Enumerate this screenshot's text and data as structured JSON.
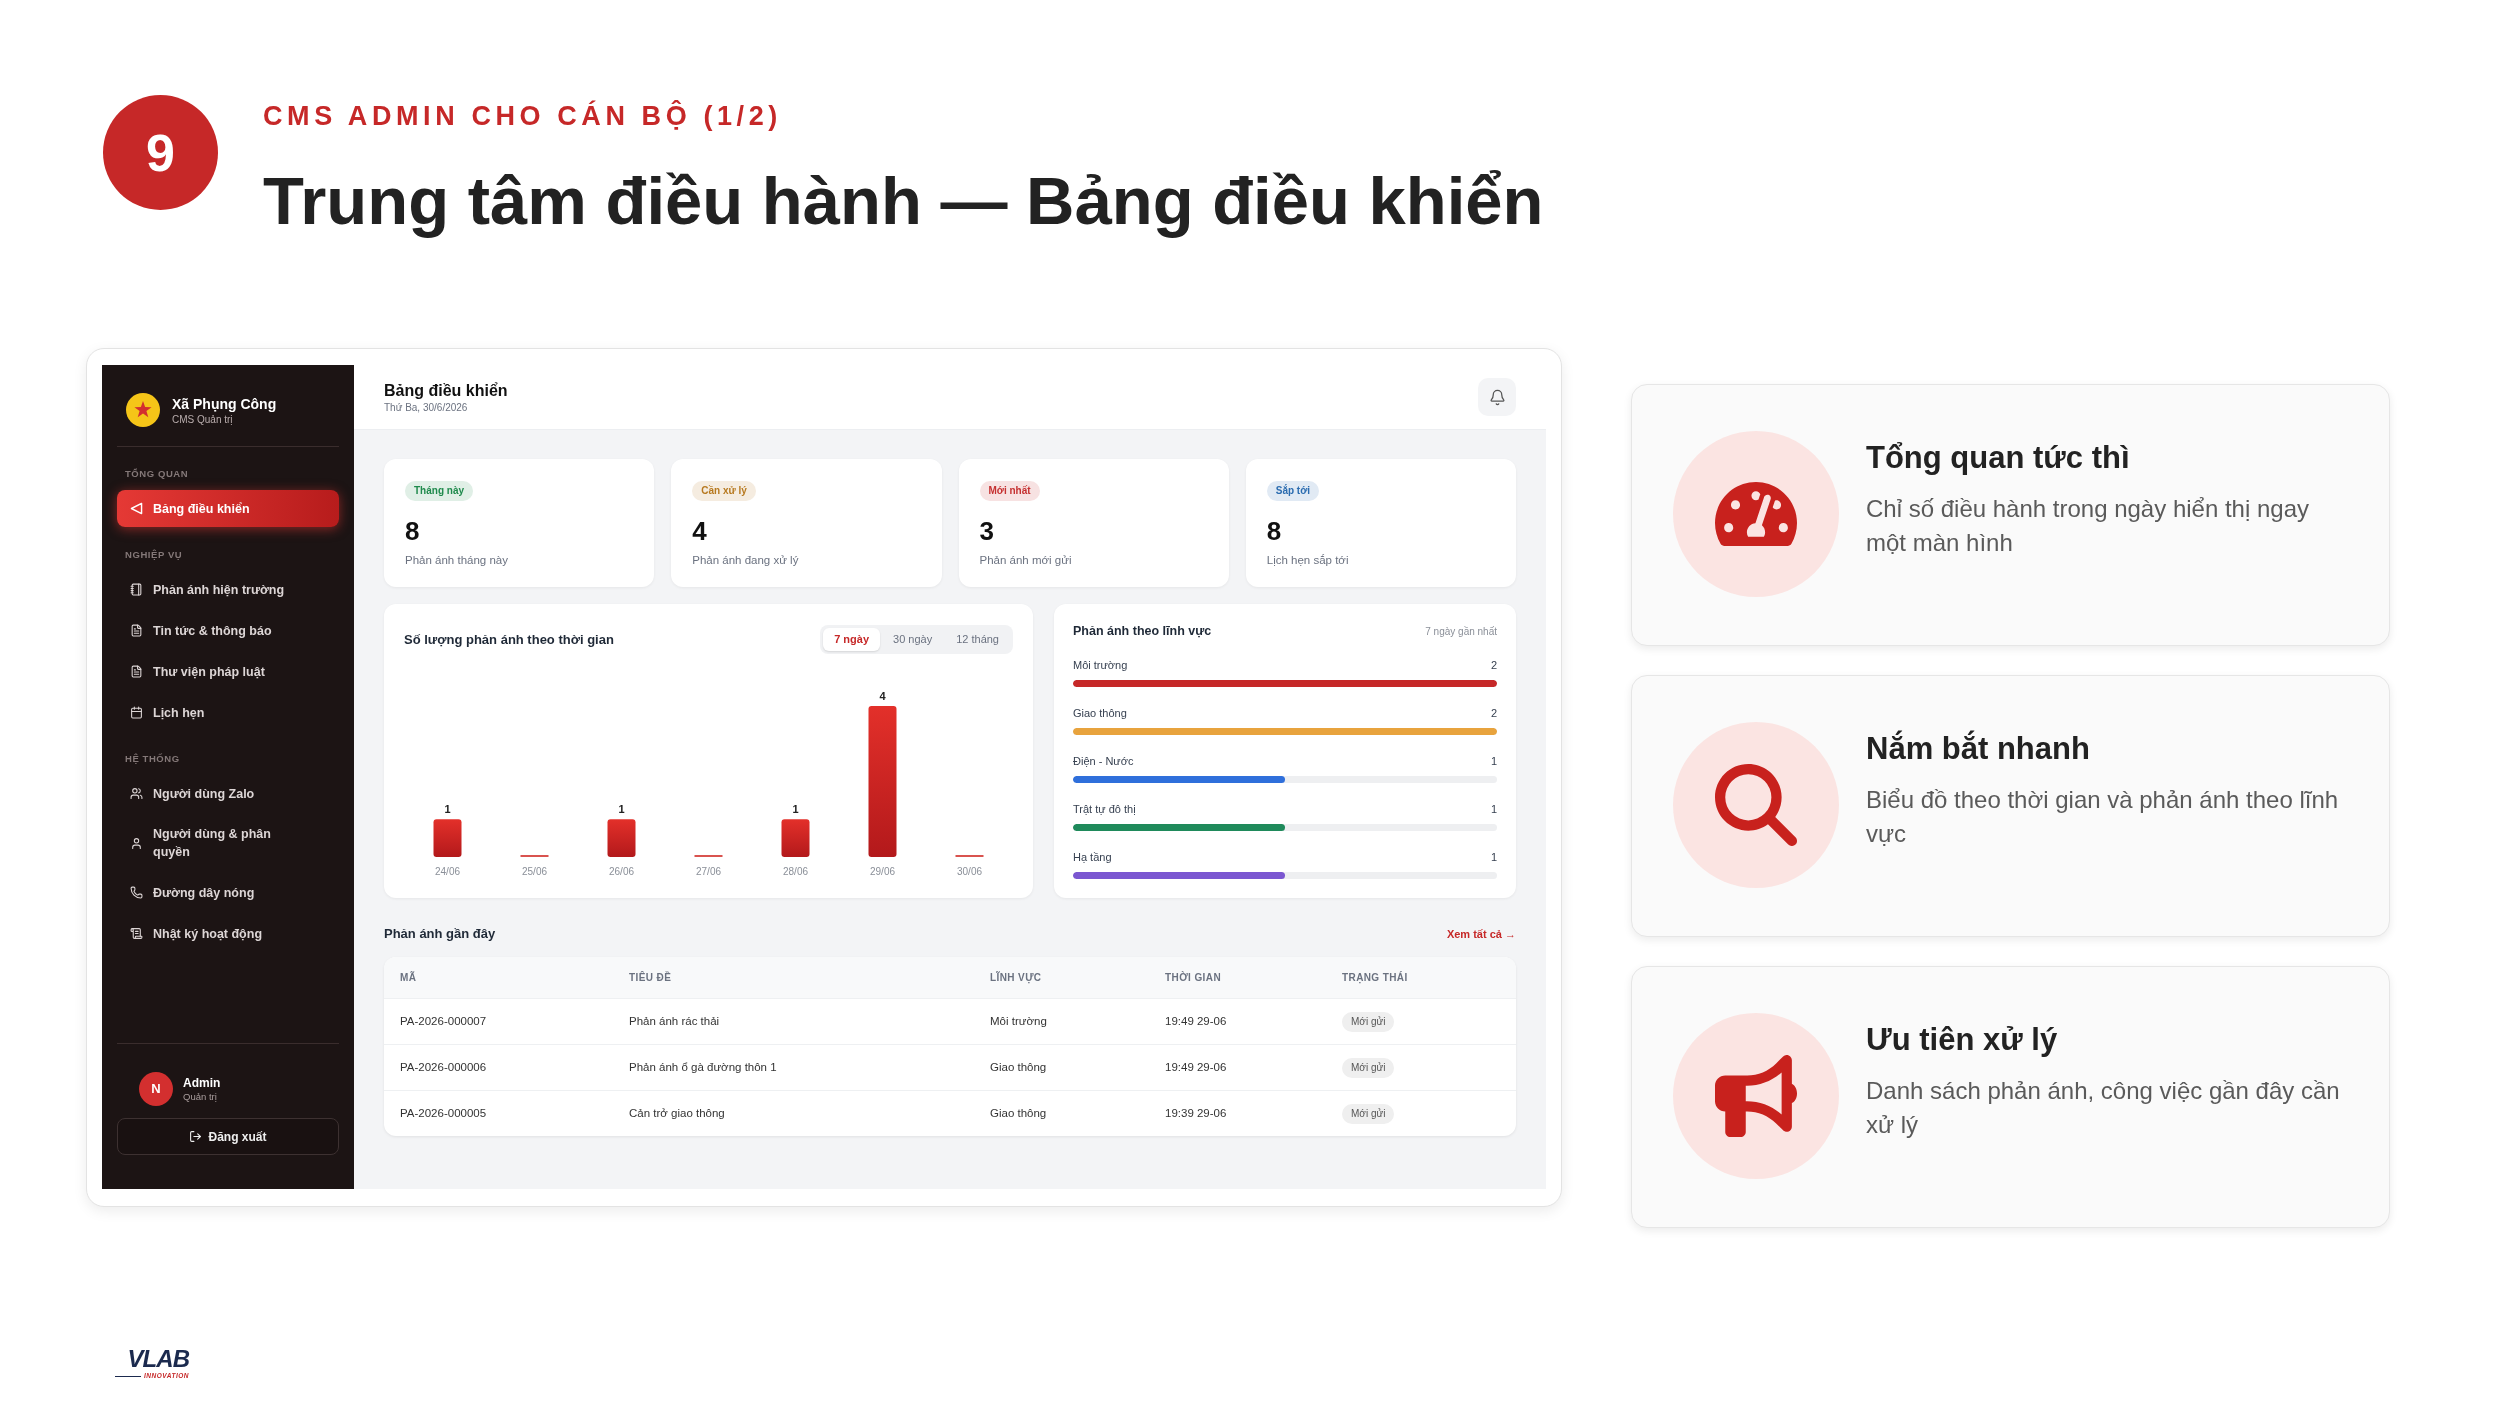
{
  "slide": {
    "number": "9",
    "kicker": "CMS ADMIN CHO CÁN BỘ (1/2)",
    "title": "Trung tâm điều hành — Bảng điều khiển"
  },
  "dashboard": {
    "sidebar": {
      "org_name": "Xã Phụng Công",
      "org_role": "CMS Quản trị",
      "sections": [
        {
          "label": "TỔNG QUAN",
          "items": [
            {
              "label": "Bảng điều khiển",
              "selected": true
            }
          ]
        },
        {
          "label": "NGHIỆP VỤ",
          "items": [
            {
              "label": "Phản ánh hiện trường",
              "selected": false
            },
            {
              "label": "Tin tức & thông báo",
              "selected": false
            },
            {
              "label": "Thư viện pháp luật",
              "selected": false
            },
            {
              "label": "Lịch hẹn",
              "selected": false
            }
          ]
        },
        {
          "label": "HỆ THỐNG",
          "items": [
            {
              "label": "Người dùng Zalo",
              "selected": false
            },
            {
              "label": "Người dùng & phân quyền",
              "selected": false
            },
            {
              "label": "Đường dây nóng",
              "selected": false
            },
            {
              "label": "Nhật ký hoạt động",
              "selected": false
            }
          ]
        }
      ],
      "user": {
        "initial": "N",
        "name": "Admin",
        "role": "Quản trị"
      },
      "logout": "Đăng xuất"
    },
    "header": {
      "title": "Bảng điều khiển",
      "date": "Thứ Ba, 30/6/2026"
    },
    "stats": [
      {
        "tag": "Tháng này",
        "color": "#1f8a4c",
        "value": "8",
        "label": "Phản ánh tháng này"
      },
      {
        "tag": "Cần xử lý",
        "color": "#b7791f",
        "value": "4",
        "label": "Phản ánh đang xử lý"
      },
      {
        "tag": "Mới nhất",
        "color": "#c53030",
        "value": "3",
        "label": "Phản ánh mới gửi"
      },
      {
        "tag": "Sắp tới",
        "color": "#2b6cb0",
        "value": "8",
        "label": "Lịch hẹn sắp tới"
      }
    ],
    "time_chart": {
      "ranges": [
        {
          "label": "7 ngày",
          "selected": true
        },
        {
          "label": "30 ngày",
          "selected": false
        },
        {
          "label": "12 tháng",
          "selected": false
        }
      ],
      "chart_data": {
        "type": "bar",
        "title": "Số lượng phản ánh theo thời gian",
        "categories": [
          "24/06",
          "25/06",
          "26/06",
          "27/06",
          "28/06",
          "29/06",
          "30/06"
        ],
        "values": [
          1,
          0,
          1,
          0,
          1,
          4,
          0
        ],
        "value_labels": [
          "1",
          null,
          "1",
          null,
          "1",
          "4",
          null
        ]
      }
    },
    "category_panel": {
      "title": "Phản ánh theo lĩnh vực",
      "period": "7 ngày gần nhất",
      "items": [
        {
          "name": "Môi trường",
          "count": "2",
          "level": 1,
          "color": "#c62828"
        },
        {
          "name": "Giao thông",
          "count": "2",
          "level": 1,
          "color": "#e8a33d"
        },
        {
          "name": "Điện - Nước",
          "count": "1",
          "level": 0.5,
          "color": "#2f6fdb"
        },
        {
          "name": "Trật tự đô thị",
          "count": "1",
          "level": 0.5,
          "color": "#1f8a5b"
        },
        {
          "name": "Hạ tầng",
          "count": "1",
          "level": 0.5,
          "color": "#7b57d1"
        }
      ]
    },
    "recent": {
      "title": "Phản ánh gần đây",
      "view_all": "Xem tất cả →",
      "columns": [
        "MÃ",
        "TIÊU ĐỀ",
        "LĨNH VỰC",
        "THỜI GIAN",
        "TRẠNG THÁI"
      ],
      "rows": [
        {
          "code": "PA-2026-000007",
          "title": "Phản ánh rác thải",
          "field": "Môi trường",
          "time": "19:49 29-06",
          "status": "Mới gửi"
        },
        {
          "code": "PA-2026-000006",
          "title": "Phản ánh ổ gà đường thôn 1",
          "field": "Giao thông",
          "time": "19:49 29-06",
          "status": "Mới gửi"
        },
        {
          "code": "PA-2026-000005",
          "title": "Cản trở giao thông",
          "field": "Giao thông",
          "time": "19:39 29-06",
          "status": "Mới gửi"
        }
      ]
    }
  },
  "features": [
    {
      "title": "Tổng quan tức thì",
      "description": "Chỉ số điều hành trong ngày hiển thị ngay một màn hình"
    },
    {
      "title": "Nắm bắt nhanh",
      "description": "Biểu đồ theo thời gian và phản ánh theo lĩnh vực"
    },
    {
      "title": "Ưu tiên xử lý",
      "description": "Danh sách phản ánh, công việc gần đây cần xử lý"
    }
  ],
  "logo": {
    "wordmark": "VLAB",
    "tagline": "INNOVATION"
  }
}
